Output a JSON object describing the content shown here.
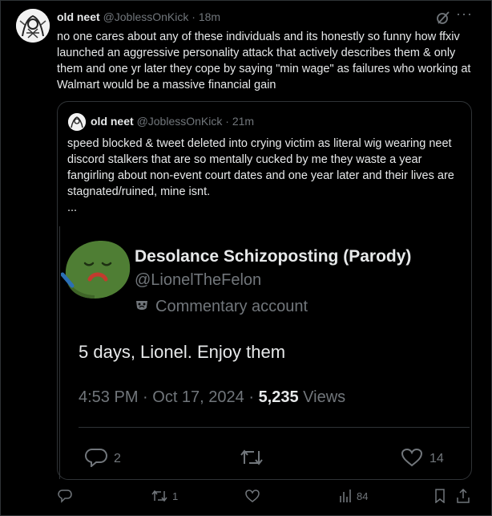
{
  "tweet": {
    "display_name": "old neet",
    "handle": "@JoblessOnKick",
    "separator": "·",
    "time": "18m",
    "text": "no one cares about any of these individuals and its honestly so funny how ffxiv launched an aggressive personality attack that actively describes them & only them and one yr later they cope by saying \"min wage\" as failures who working at Walmart would be a massive financial gain",
    "more_label": "···"
  },
  "quote": {
    "display_name": "old neet",
    "handle": "@JoblessOnKick",
    "separator": "·",
    "time": "21m",
    "text": "speed blocked & tweet deleted into crying victim as literal wig wearing neet discord stalkers that are so mentally cucked by me they waste a year fangirling about non-event court dates and one year later and their lives are stagnated/ruined, mine isnt.",
    "ellipsis": "...",
    "embed": {
      "display_name": "Desolance Schizoposting (Parody)",
      "handle": "@LionelTheFelon",
      "badge": "Commentary account",
      "text": "5 days, Lionel. Enjoy them",
      "meta_prefix": "4:53 PM · Oct 17, 2024 · ",
      "views_count": "5,235",
      "views_label": " Views",
      "replies": "2",
      "likes": "14"
    }
  },
  "actions": {
    "replies": "",
    "retweets": "1",
    "likes": "",
    "views": "84"
  },
  "colors": {
    "background": "#000000",
    "text": "#e7e9ea",
    "muted": "#71767b",
    "border": "#2f3336",
    "frog_green": "#4f7e34"
  },
  "icons": [
    "avatar-sketch",
    "grok-icon",
    "more-icon",
    "mask-icon",
    "reply-icon",
    "retweet-icon",
    "like-icon",
    "views-icon",
    "bookmark-icon",
    "share-icon"
  ]
}
